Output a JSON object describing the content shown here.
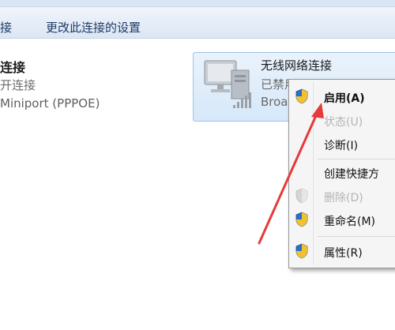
{
  "toolbar": {
    "item_partial": "接",
    "change_settings": "更改此连接的设置"
  },
  "left_connection": {
    "name": "连接",
    "status": "开连接",
    "device": "Miniport (PPPOE)"
  },
  "wifi_connection": {
    "name": "无线网络连接",
    "status": "已禁用",
    "device": "Broa"
  },
  "context_menu": {
    "items": [
      {
        "label": "启用(A)",
        "icon": "shield-icon",
        "enabled": true,
        "bold": true
      },
      {
        "label": "状态(U)",
        "icon": "",
        "enabled": false
      },
      {
        "label": "诊断(I)",
        "icon": "",
        "enabled": true
      },
      {
        "label": "创建快捷方",
        "icon": "",
        "enabled": true
      },
      {
        "label": "删除(D)",
        "icon": "shield-icon",
        "enabled": false
      },
      {
        "label": "重命名(M)",
        "icon": "shield-icon",
        "enabled": true
      },
      {
        "label": "属性(R)",
        "icon": "shield-icon",
        "enabled": true
      }
    ]
  },
  "colors": {
    "accent_arrow": "#e8393a",
    "selection_bg": "#d6e8f9"
  }
}
